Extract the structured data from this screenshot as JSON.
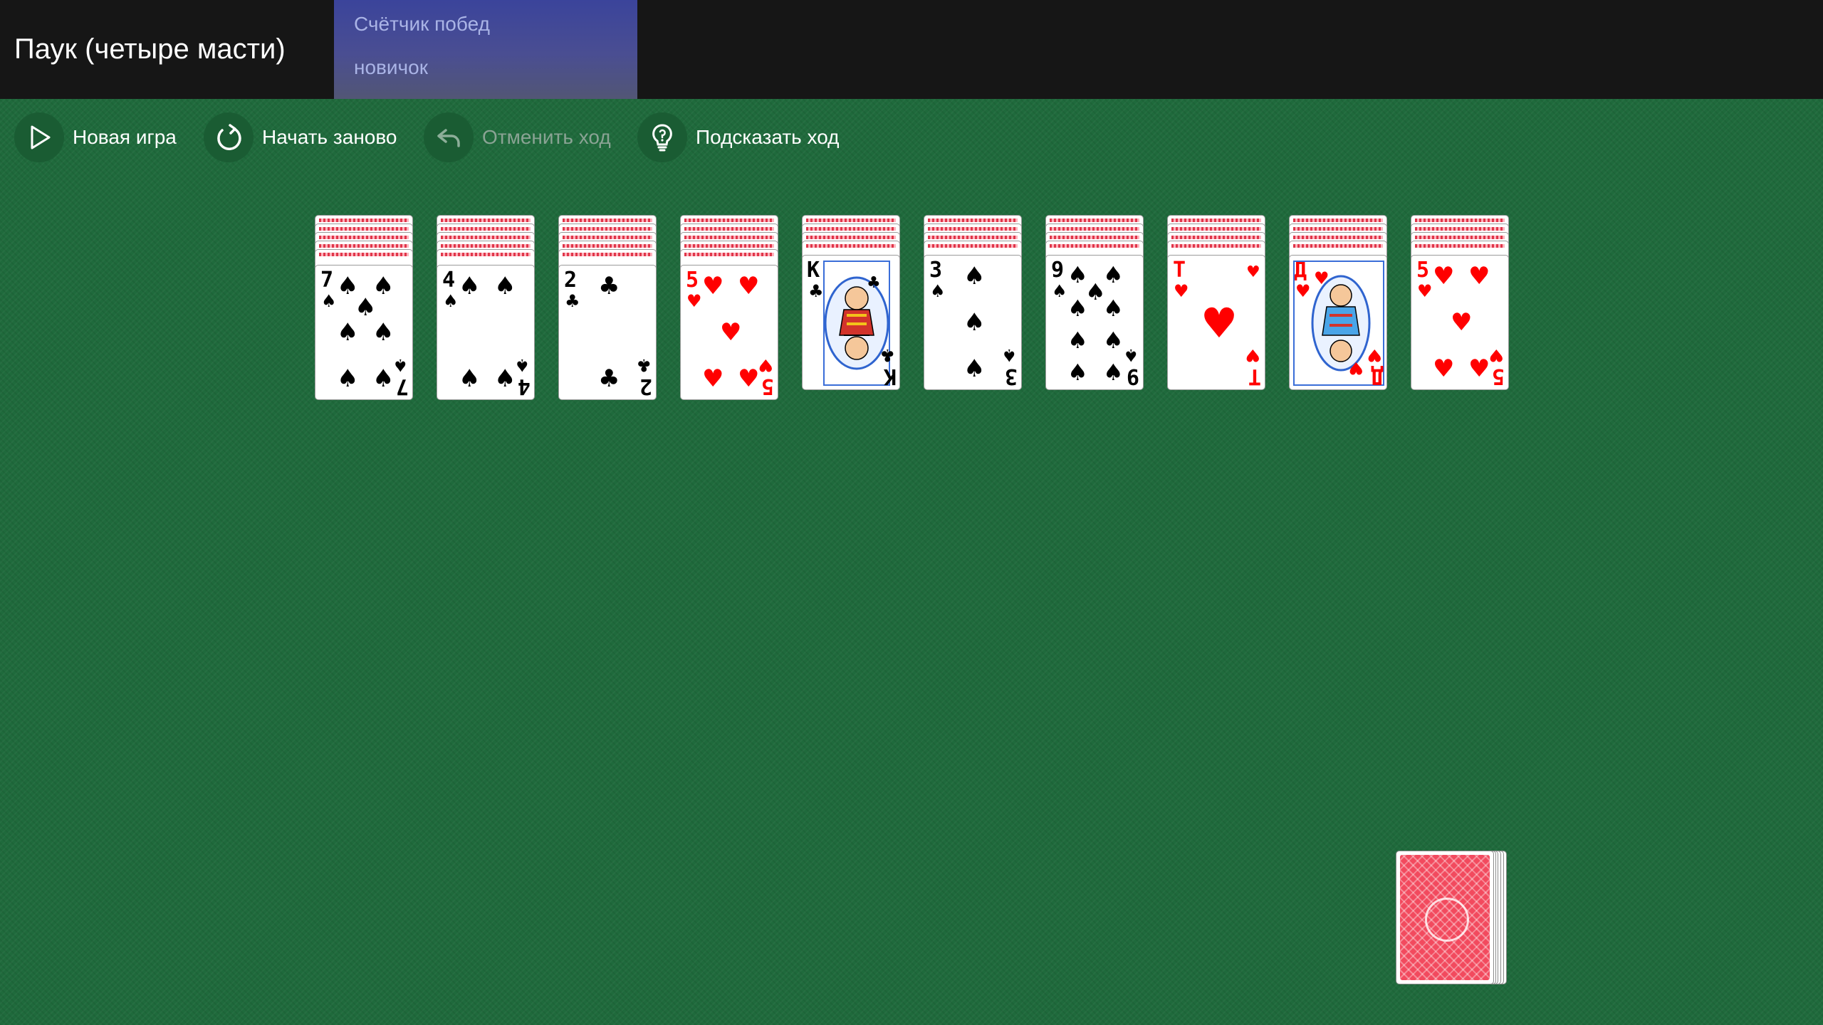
{
  "header": {
    "title": "Паук (четыре масти)",
    "win_counter_label": "Счётчик побед",
    "level": "новичок"
  },
  "toolbar": {
    "new_game": "Новая игра",
    "restart": "Начать заново",
    "undo": "Отменить ход",
    "hint": "Подсказать ход"
  },
  "colors": {
    "felt": "#1f6a3c",
    "header_bg": "#161616",
    "red_suit": "#ff0000",
    "black_suit": "#000000",
    "card_back": "#f24a5e"
  },
  "piles": [
    {
      "hidden": 5,
      "rank": "7",
      "suit": "spades"
    },
    {
      "hidden": 5,
      "rank": "4",
      "suit": "spades"
    },
    {
      "hidden": 5,
      "rank": "2",
      "suit": "clubs"
    },
    {
      "hidden": 5,
      "rank": "5",
      "suit": "hearts"
    },
    {
      "hidden": 4,
      "rank": "К",
      "suit": "clubs"
    },
    {
      "hidden": 4,
      "rank": "3",
      "suit": "spades"
    },
    {
      "hidden": 4,
      "rank": "9",
      "suit": "spades"
    },
    {
      "hidden": 4,
      "rank": "Т",
      "suit": "hearts"
    },
    {
      "hidden": 4,
      "rank": "Д",
      "suit": "hearts"
    },
    {
      "hidden": 4,
      "rank": "5",
      "suit": "hearts"
    }
  ]
}
